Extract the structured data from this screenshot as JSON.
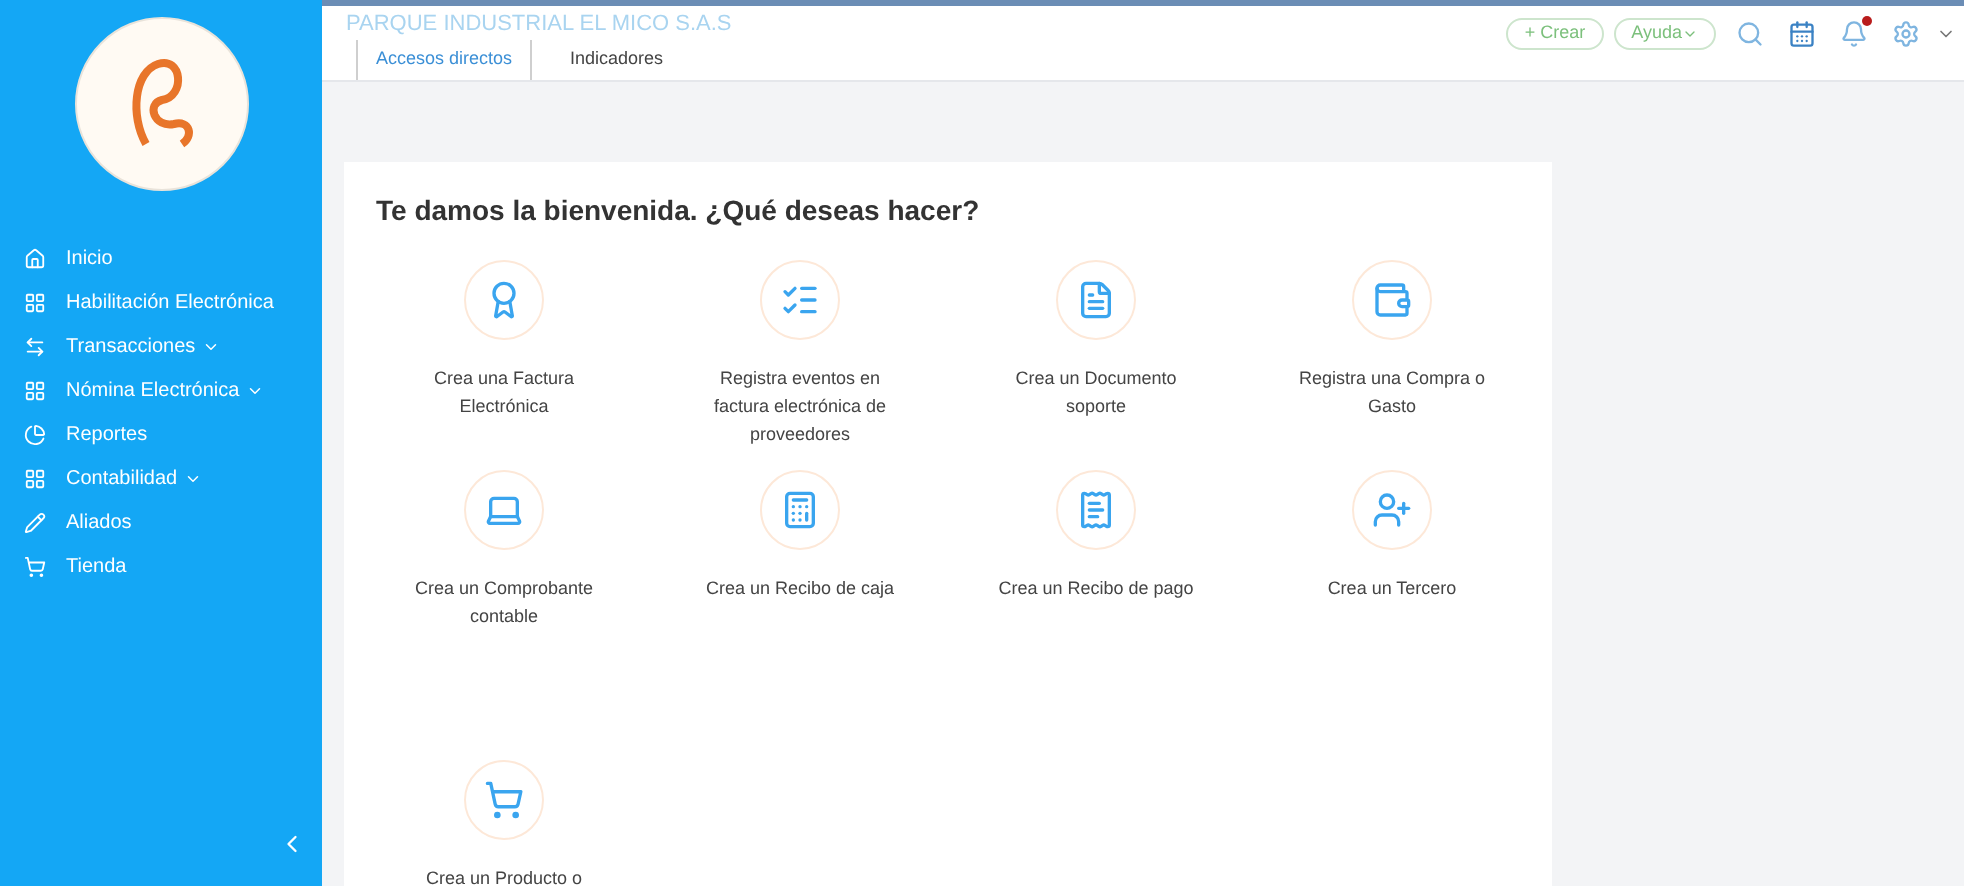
{
  "sidebar": {
    "items": [
      {
        "label": "Inicio",
        "has_submenu": false
      },
      {
        "label": "Habilitación Electrónica",
        "has_submenu": false
      },
      {
        "label": "Transacciones",
        "has_submenu": true
      },
      {
        "label": "Nómina Electrónica",
        "has_submenu": true
      },
      {
        "label": "Reportes",
        "has_submenu": false
      },
      {
        "label": "Contabilidad",
        "has_submenu": true
      },
      {
        "label": "Aliados",
        "has_submenu": false
      },
      {
        "label": "Tienda",
        "has_submenu": false
      }
    ]
  },
  "header": {
    "company": "PARQUE INDUSTRIAL EL MICO S.A.S",
    "create_button": "+ Crear",
    "help_button": "Ayuda",
    "notification_dot": true
  },
  "tabs": [
    {
      "label": "Accesos directos",
      "selected": true
    },
    {
      "label": "Indicadores",
      "selected": false
    }
  ],
  "welcome": {
    "title": "Te damos la bienvenida. ¿Qué deseas hacer?",
    "actions": [
      {
        "label": "Crea una Factura Electrónica"
      },
      {
        "label": "Registra eventos en factura electrónica de proveedores"
      },
      {
        "label": "Crea un Documento soporte"
      },
      {
        "label": "Registra una Compra o Gasto"
      },
      {
        "label": "Crea un Comprobante contable"
      },
      {
        "label": "Crea un Recibo de caja"
      },
      {
        "label": "Crea un Recibo de pago"
      },
      {
        "label": "Crea un Tercero"
      },
      {
        "label": "Crea un Producto o"
      }
    ]
  }
}
